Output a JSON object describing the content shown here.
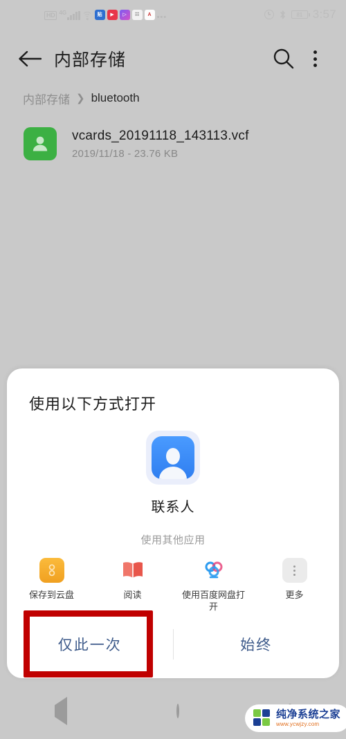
{
  "statusbar": {
    "hd_label": "HD",
    "network_label": "4G",
    "app_badges": [
      "贴",
      "▶",
      "▷",
      "☷",
      "A"
    ],
    "overflow": "•••",
    "battery_level": "81",
    "time": "3:57",
    "icons": [
      "alarm-icon",
      "bluetooth-icon",
      "battery-icon"
    ]
  },
  "toolbar": {
    "back_icon": "arrow-left-icon",
    "title": "内部存储",
    "search_icon": "search-icon",
    "overflow_icon": "kebab-menu-icon"
  },
  "breadcrumb": {
    "root": "内部存储",
    "separator": "❯",
    "current": "bluetooth"
  },
  "file": {
    "icon": "contact-file-icon",
    "name": "vcards_20191118_143113.vcf",
    "meta": "2019/11/18 - 23.76 KB"
  },
  "sheet": {
    "title": "使用以下方式打开",
    "primary_app": {
      "icon": "contacts-app-icon",
      "label": "联系人"
    },
    "other_apps_title": "使用其他应用",
    "other_apps": [
      {
        "icon": "cloud-save-icon",
        "label": "保存到云盘"
      },
      {
        "icon": "book-reader-icon",
        "label": "阅读"
      },
      {
        "icon": "baidu-netdisk-icon",
        "label": "使用百度网盘打开"
      },
      {
        "icon": "more-dots-icon",
        "label": "更多"
      }
    ],
    "actions": {
      "once": "仅此一次",
      "always": "始终"
    }
  },
  "navbar": {
    "back": "nav-back-icon",
    "home": "nav-home-icon",
    "recents": "nav-recents-icon"
  },
  "watermark": {
    "name": "纯净系统之家",
    "url": "www.ycwjzy.com"
  },
  "colors": {
    "page_bg": "#c9c9c9",
    "sheet_bg": "#ffffff",
    "accent_blue": "#3d5a8a",
    "file_icon_green": "#3cb043",
    "annotation_red": "#c00000"
  }
}
